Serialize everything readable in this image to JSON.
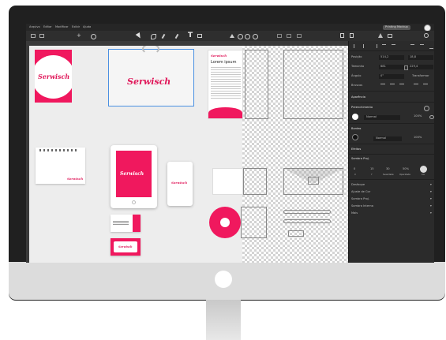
{
  "menu": [
    "Arquivo",
    "Editar",
    "Modificar",
    "Exibir",
    "Ajuda"
  ],
  "top_badge": "Printing Mockup",
  "toolbar_icons": [
    "grid-icon",
    "layers-icon",
    "pointer-icon",
    "pen-icon",
    "pencil-icon",
    "brush-icon",
    "text-tool-icon",
    "image-icon",
    "shapes-icon",
    "boolean-icon",
    "align-icon",
    "share-icon",
    "settings-icon"
  ],
  "brand": {
    "name": "Serwisch",
    "small": "Serwisch"
  },
  "document": {
    "title": "Lorem ipsum"
  },
  "panel": {
    "position_label": "Posição",
    "position_x": "514,2",
    "position_y": "18,8",
    "size_label": "Tamanho",
    "size_w": "681",
    "size_h": "229,4",
    "angle_label": "Ângulo",
    "angle_value": "0°",
    "transform_label": "Transformar",
    "repeat_label": "Bruscos",
    "appearance_label": "Aparência",
    "fill_label": "Preenchimento",
    "fill_mode": "Normal",
    "fill_opacity": "100%",
    "border_label": "Bordas",
    "border_mode": "Normal",
    "border_opacity": "100%",
    "effects_label": "Efeitos",
    "shadow_label": "Sombra Proj.",
    "shadow_values": [
      "0",
      "15",
      "30",
      "50%"
    ],
    "shadow_captions": [
      "X",
      "Y",
      "Suavidade",
      "Opacidade",
      "Cor"
    ],
    "sections": [
      "Desfoque",
      "Ajuste de Cor",
      "Sombra Proj.",
      "Sombra Interna",
      "Mais"
    ]
  },
  "colors": {
    "accent": "#f0185e",
    "dark_ui": "#2b2b2b",
    "monitor": "#dcdcdc"
  }
}
